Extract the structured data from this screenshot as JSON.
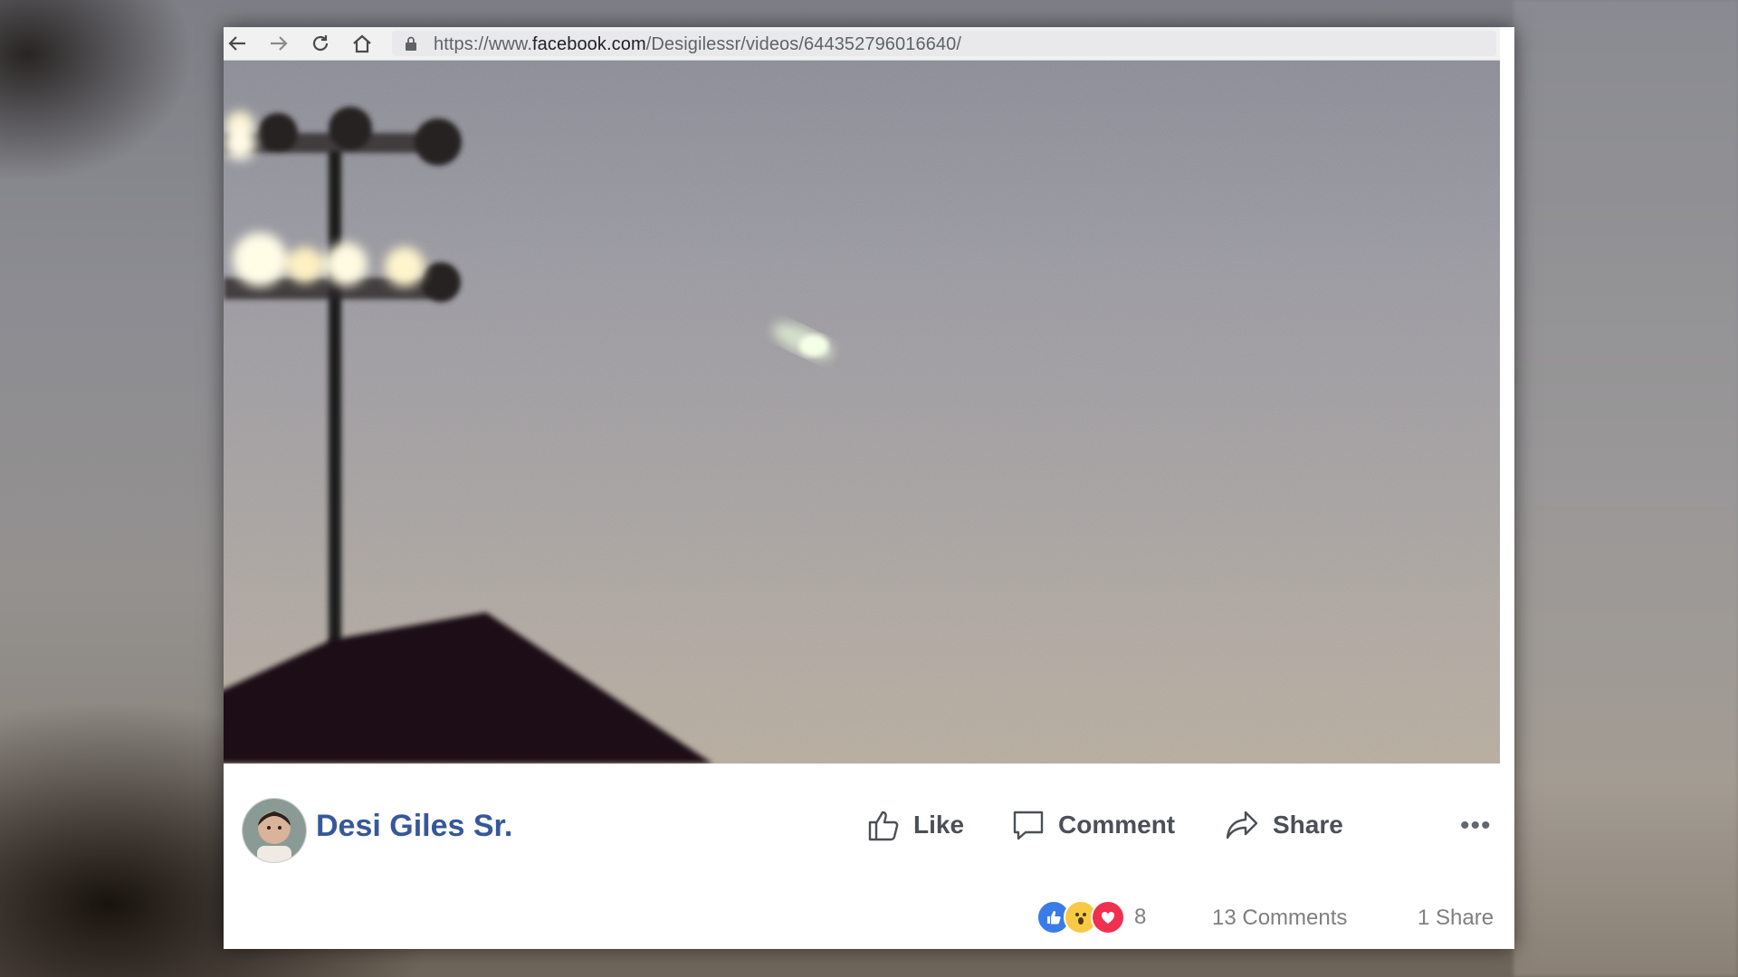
{
  "browser": {
    "url_prefix": "https://www.",
    "url_host": "facebook.com",
    "url_path": "/Desigilessr/videos/644352796016640/"
  },
  "post": {
    "author_name": "Desi Giles Sr.",
    "actions": {
      "like_label": "Like",
      "comment_label": "Comment",
      "share_label": "Share"
    },
    "reaction_count": "8",
    "comments_count": "13 Comments",
    "shares_count": "1 Share"
  },
  "icons": {
    "back": "arrow-left-icon",
    "forward": "arrow-right-icon",
    "reload": "reload-icon",
    "home": "home-icon",
    "lock": "lock-icon",
    "like": "thumbs-up-icon",
    "comment": "speech-bubble-icon",
    "share": "share-arrow-icon",
    "more": "ellipsis-icon"
  },
  "colors": {
    "author_link": "#365899",
    "action_text": "#4b4f56",
    "meta_text": "#7f7f7f",
    "reaction_like": "#3b7be8",
    "reaction_wow": "#f7c945",
    "reaction_love": "#f0304f"
  }
}
